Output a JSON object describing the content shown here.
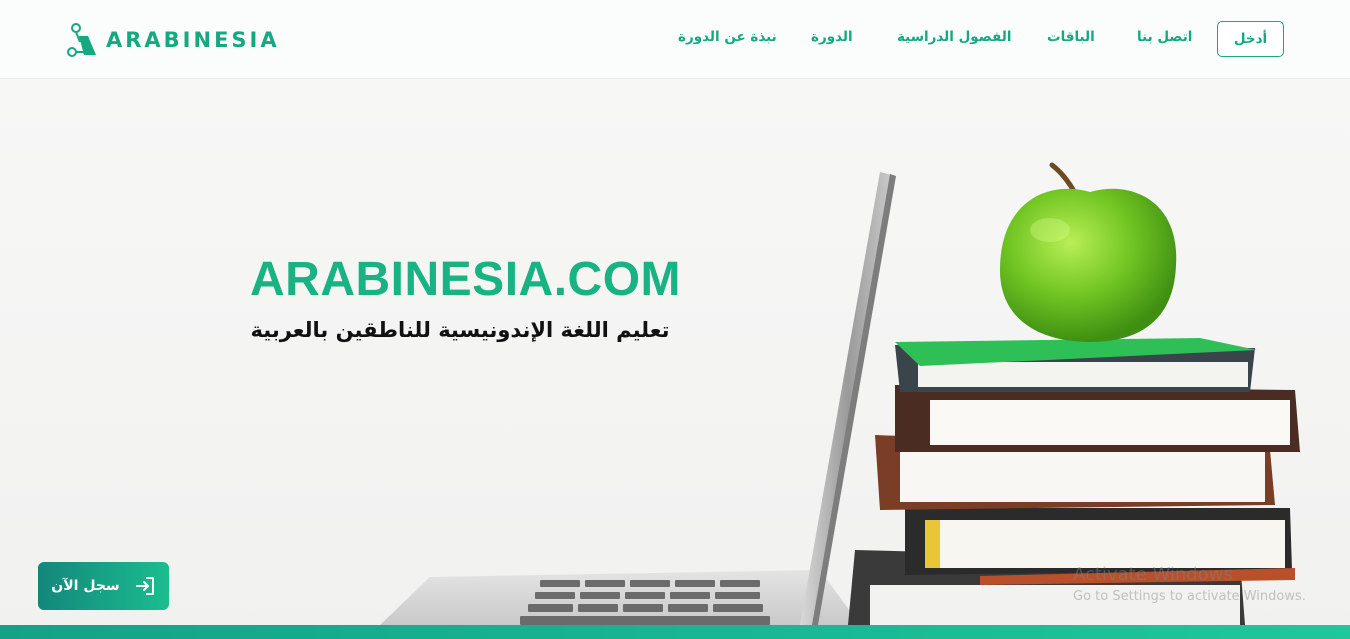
{
  "header": {
    "logo_text": "ARABINESIA",
    "nav": {
      "about": "نبذة عن الدورة",
      "course": "الدورة",
      "classes": "الفصول الدراسية",
      "packages": "الباقات",
      "contact": "اتصل بنا"
    },
    "login_label": "أدخل"
  },
  "hero": {
    "title": "ARABINESIA.COM",
    "subtitle": "تعليم اللغة الإندونيسية للناطقين بالعربية",
    "register_label": "سجل الآن",
    "register_icon": "login-arrow-icon"
  },
  "watermark": {
    "line1": "Activate Windows",
    "line2": "Go to Settings to activate Windows."
  },
  "colors": {
    "brand": "#14a981",
    "title": "#19b283",
    "button_start": "#13877c",
    "button_end": "#1bbd8f"
  }
}
